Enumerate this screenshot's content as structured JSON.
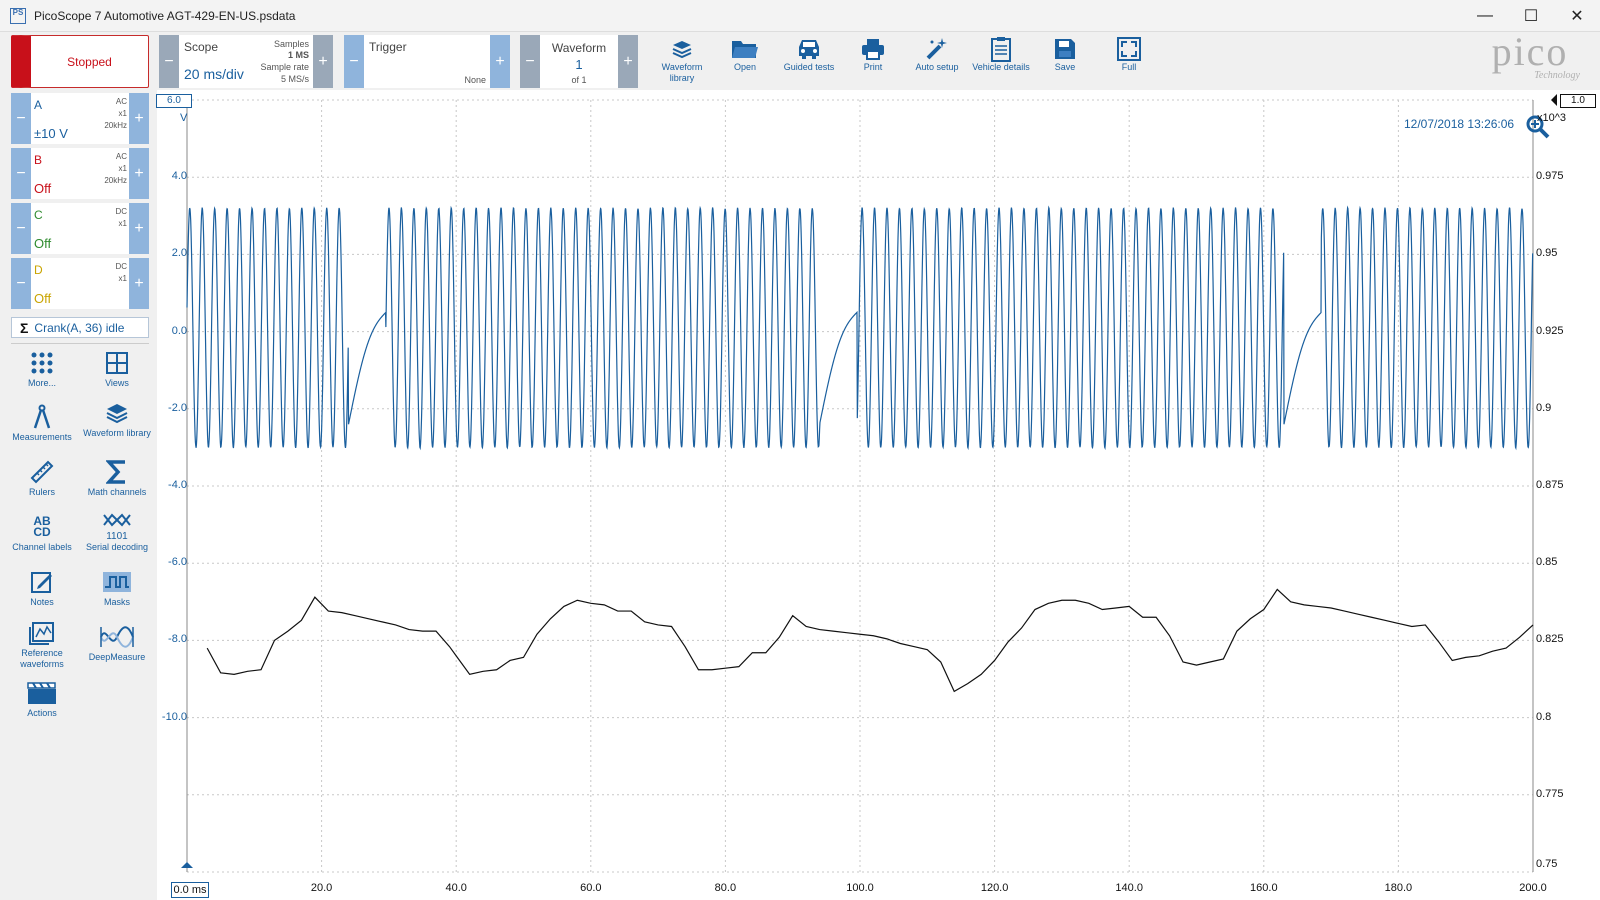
{
  "window": {
    "title": "PicoScope 7 Automotive AGT-429-EN-US.psdata",
    "app_icon": "PS",
    "minimize": "—",
    "maximize": "☐",
    "close": "✕"
  },
  "toolbar": {
    "run_state": "Stopped",
    "scope": {
      "label": "Scope",
      "timebase": "20 ms/div",
      "samples_label": "Samples",
      "samples_value": "1 MS",
      "rate_label": "Sample rate",
      "rate_value": "5 MS/s"
    },
    "trigger": {
      "label": "Trigger",
      "mode": "None"
    },
    "waveform": {
      "label": "Waveform",
      "index": "1",
      "of": "of 1"
    },
    "minus": "−",
    "plus": "+",
    "tools": [
      {
        "icon": "waveform-library-icon",
        "label": "Waveform library"
      },
      {
        "icon": "open-folder-icon",
        "label": "Open"
      },
      {
        "icon": "car-icon",
        "label": "Guided tests"
      },
      {
        "icon": "printer-icon",
        "label": "Print"
      },
      {
        "icon": "magic-wand-icon",
        "label": "Auto setup"
      },
      {
        "icon": "clipboard-icon",
        "label": "Vehicle details"
      },
      {
        "icon": "save-disk-icon",
        "label": "Save"
      },
      {
        "icon": "fullscreen-icon",
        "label": "Full"
      }
    ],
    "logo": {
      "word": "pico",
      "sub": "Technology"
    }
  },
  "channels": [
    {
      "name": "A",
      "value": "±10 V",
      "coupling": "AC",
      "probe": "x1",
      "bw": "20kHz",
      "color": "#1a5f9e"
    },
    {
      "name": "B",
      "value": "Off",
      "coupling": "AC",
      "probe": "x1",
      "bw": "20kHz",
      "color": "#c8101a"
    },
    {
      "name": "C",
      "value": "Off",
      "coupling": "DC",
      "probe": "x1",
      "bw": "",
      "color": "#2e8b2e"
    },
    {
      "name": "D",
      "value": "Off",
      "coupling": "DC",
      "probe": "x1",
      "bw": "",
      "color": "#c9a400"
    }
  ],
  "math_channel": {
    "symbol": "Σ",
    "label": "Crank(A, 36) idle"
  },
  "side_tools": [
    {
      "icon": "more-grid-icon",
      "label": "More..."
    },
    {
      "icon": "views-icon",
      "label": "Views"
    },
    {
      "icon": "measurements-icon",
      "label": "Measurements"
    },
    {
      "icon": "waveform-library-icon",
      "label": "Waveform library"
    },
    {
      "icon": "ruler-icon",
      "label": "Rulers"
    },
    {
      "icon": "sigma-icon",
      "label": "Math channels"
    },
    {
      "icon": "channel-labels-icon",
      "label": "Channel labels"
    },
    {
      "icon": "serial-decoding-icon",
      "label": "Serial decoding"
    },
    {
      "icon": "notes-icon",
      "label": "Notes"
    },
    {
      "icon": "masks-icon",
      "label": "Masks"
    },
    {
      "icon": "reference-waveforms-icon",
      "label": "Reference waveforms"
    },
    {
      "icon": "deepmeasure-icon",
      "label": "DeepMeasure"
    },
    {
      "icon": "actions-icon",
      "label": "Actions"
    }
  ],
  "side_icon_text": {
    "channel_labels": "AB CD",
    "serial_bits": "1101"
  },
  "plot": {
    "timestamp": "12/07/2018 13:26:06",
    "left_axis_unit": "V",
    "right_axis_unit": "x10^3",
    "left_top_marker": "6.0",
    "right_top_marker": "1.0",
    "bottom_left_marker": "0.0 ms",
    "colors": {
      "channel_a": "#1a5f9e",
      "math": "#111111",
      "grid": "#c8c8c8"
    }
  },
  "chart_data": {
    "type": "line",
    "x_unit": "ms",
    "x_ticks": [
      "0.0 ms",
      "20.0",
      "40.0",
      "60.0",
      "80.0",
      "100.0",
      "120.0",
      "140.0",
      "160.0",
      "180.0",
      "200.0"
    ],
    "xlim": [
      0,
      200
    ],
    "left_y_ticks": [
      "4.0",
      "2.0",
      "0.0",
      "-2.0",
      "-4.0",
      "-6.0",
      "-8.0",
      "-10.0"
    ],
    "left_ylim": [
      -14,
      6
    ],
    "right_y_ticks": [
      "0.975",
      "0.95",
      "0.925",
      "0.9",
      "0.875",
      "0.85",
      "0.825",
      "0.8",
      "0.775",
      "0.75"
    ],
    "right_ylim": [
      0.75,
      1.0
    ],
    "grid": true,
    "series": [
      {
        "axis": "left",
        "shape": "crank-sine",
        "teeth_per_rev": 36,
        "missing_teeth": 2,
        "tooth_period_ms": 1.85,
        "amplitude_high": 3.2,
        "amplitude_low": -3.0,
        "gap_times_ms": [
          24,
          94,
          163
        ]
      },
      {
        "axis": "right",
        "x": [
          3,
          5,
          7,
          9,
          11,
          13,
          15,
          17,
          19,
          21,
          23,
          25,
          27,
          29,
          31,
          33,
          35,
          37,
          39,
          40,
          42,
          44,
          46,
          48,
          50,
          52,
          54,
          56,
          58,
          60,
          62,
          64,
          66,
          68,
          70,
          72,
          74,
          76,
          78,
          80,
          82,
          84,
          86,
          88,
          90,
          92,
          94,
          96,
          98,
          100,
          102,
          104,
          106,
          108,
          110,
          112,
          114,
          116,
          118,
          120,
          122,
          124,
          126,
          128,
          130,
          132,
          134,
          136,
          138,
          140,
          142,
          144,
          146,
          148,
          150,
          152,
          154,
          156,
          158,
          160,
          162,
          164,
          166,
          168,
          170,
          172,
          174,
          176,
          178,
          180,
          182,
          184,
          186,
          188,
          190,
          192,
          194,
          196,
          198,
          200
        ],
        "y": [
          0.8225,
          0.8145,
          0.814,
          0.815,
          0.8155,
          0.825,
          0.828,
          0.8315,
          0.839,
          0.8345,
          0.834,
          0.833,
          0.832,
          0.831,
          0.83,
          0.8285,
          0.828,
          0.828,
          0.823,
          0.82,
          0.814,
          0.815,
          0.8155,
          0.8185,
          0.8195,
          0.827,
          0.832,
          0.836,
          0.838,
          0.837,
          0.8365,
          0.8345,
          0.8345,
          0.831,
          0.83,
          0.8295,
          0.823,
          0.8155,
          0.8155,
          0.816,
          0.8165,
          0.821,
          0.821,
          0.826,
          0.833,
          0.8295,
          0.8285,
          0.828,
          0.8275,
          0.827,
          0.8265,
          0.8255,
          0.824,
          0.823,
          0.822,
          0.818,
          0.8085,
          0.811,
          0.814,
          0.8185,
          0.8245,
          0.829,
          0.835,
          0.837,
          0.838,
          0.838,
          0.837,
          0.835,
          0.8355,
          0.836,
          0.8325,
          0.8325,
          0.8265,
          0.818,
          0.817,
          0.818,
          0.819,
          0.828,
          0.832,
          0.835,
          0.8415,
          0.8375,
          0.8365,
          0.836,
          0.8355,
          0.8345,
          0.8335,
          0.8325,
          0.8315,
          0.8305,
          0.8295,
          0.83,
          0.8245,
          0.8185,
          0.8195,
          0.82,
          0.8215,
          0.8225,
          0.826,
          0.83
        ]
      }
    ]
  }
}
